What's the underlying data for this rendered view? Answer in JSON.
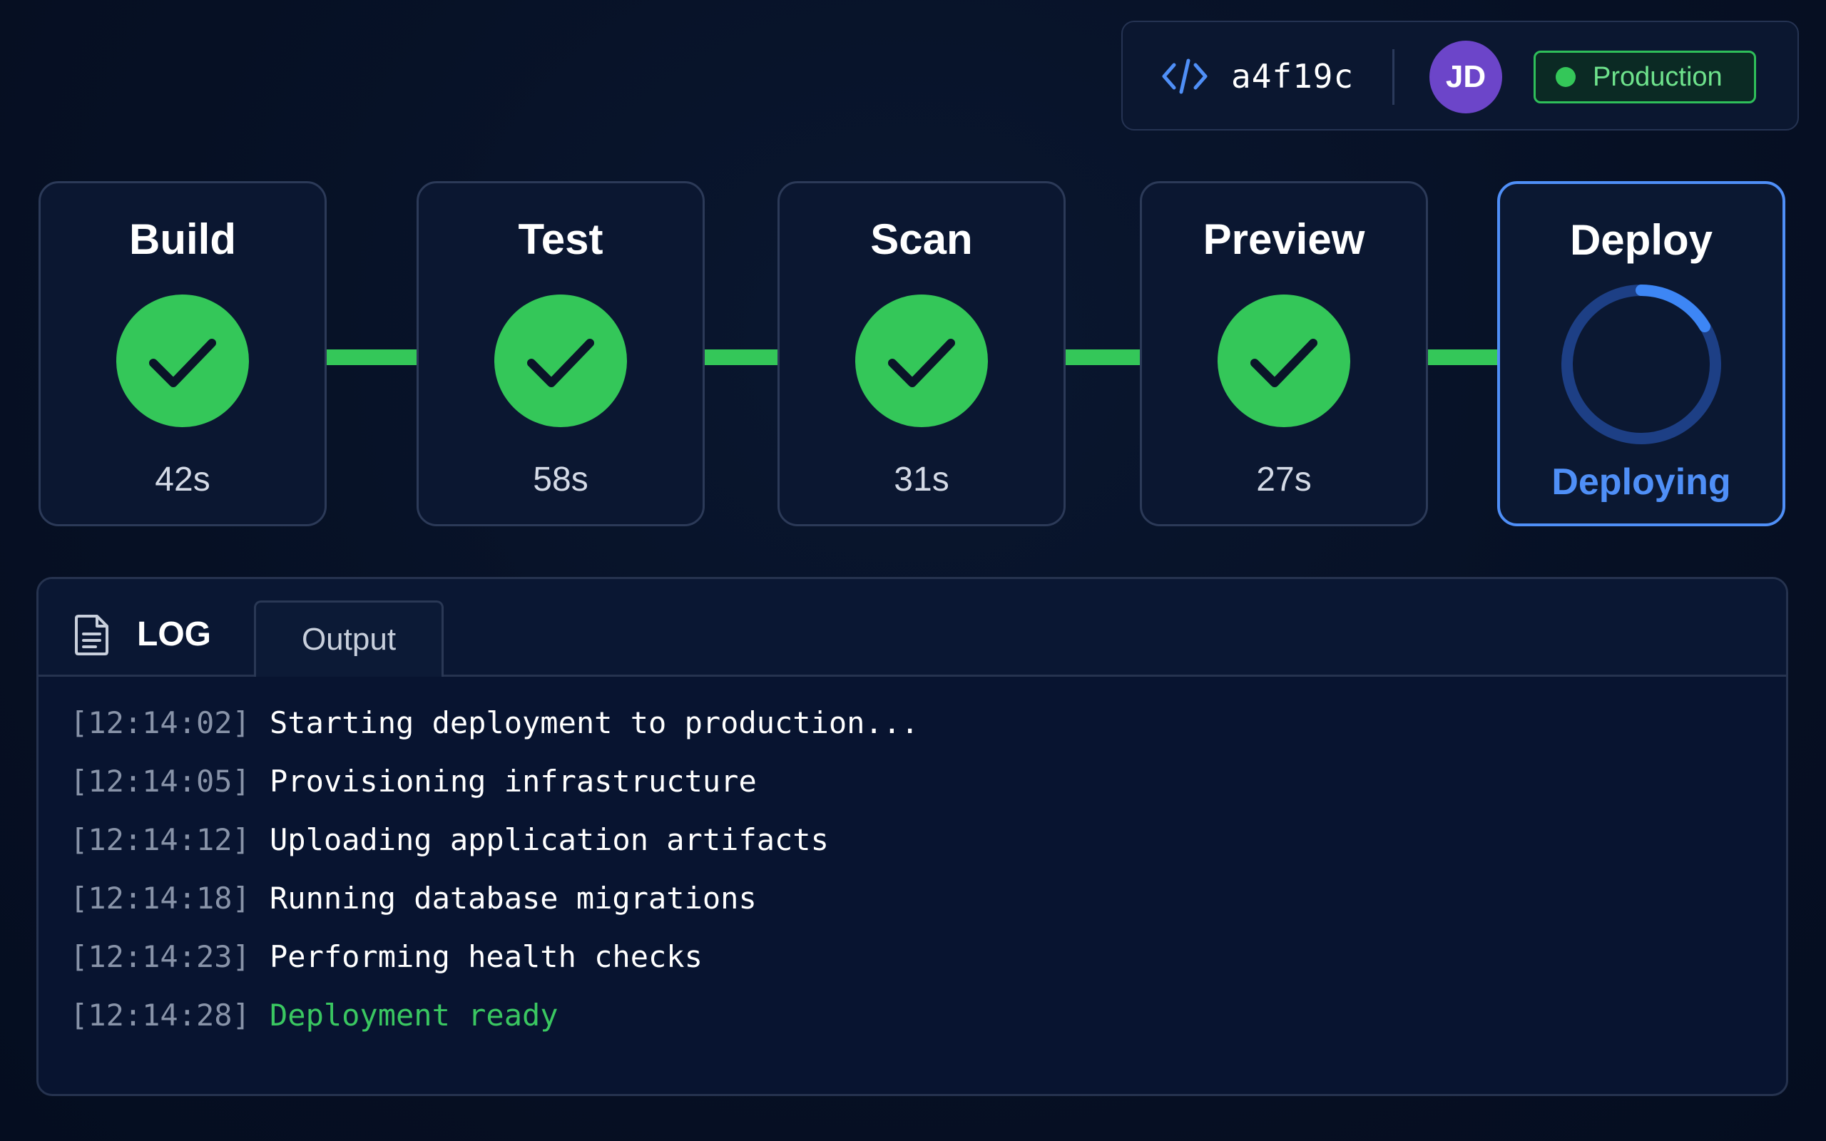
{
  "header": {
    "code_icon": "code-brackets-icon",
    "commit": "a4f19c",
    "user_initials": "JD",
    "environment": "Production",
    "environment_status_color": "#34c759"
  },
  "pipeline": {
    "stages": [
      {
        "name": "Build",
        "status": "success",
        "duration": "42s"
      },
      {
        "name": "Test",
        "status": "success",
        "duration": "58s"
      },
      {
        "name": "Scan",
        "status": "success",
        "duration": "31s"
      },
      {
        "name": "Preview",
        "status": "success",
        "duration": "27s"
      },
      {
        "name": "Deploy",
        "status": "in-progress",
        "status_label": "Deploying"
      }
    ],
    "colors": {
      "success": "#34c759",
      "active": "#4f8ff7"
    }
  },
  "log": {
    "tab_title": "LOG",
    "tab_icon": "document-icon",
    "output_tab": "Output",
    "lines": [
      {
        "time": "[12:14:02]",
        "message": "Starting deployment to production...",
        "level": "info"
      },
      {
        "time": "[12:14:05]",
        "message": "Provisioning infrastructure",
        "level": "info"
      },
      {
        "time": "[12:14:12]",
        "message": "Uploading application artifacts",
        "level": "info"
      },
      {
        "time": "[12:14:18]",
        "message": "Running database migrations",
        "level": "info"
      },
      {
        "time": "[12:14:23]",
        "message": "Performing health checks",
        "level": "info"
      },
      {
        "time": "[12:14:28]",
        "message": "Deployment ready",
        "level": "success"
      }
    ]
  }
}
